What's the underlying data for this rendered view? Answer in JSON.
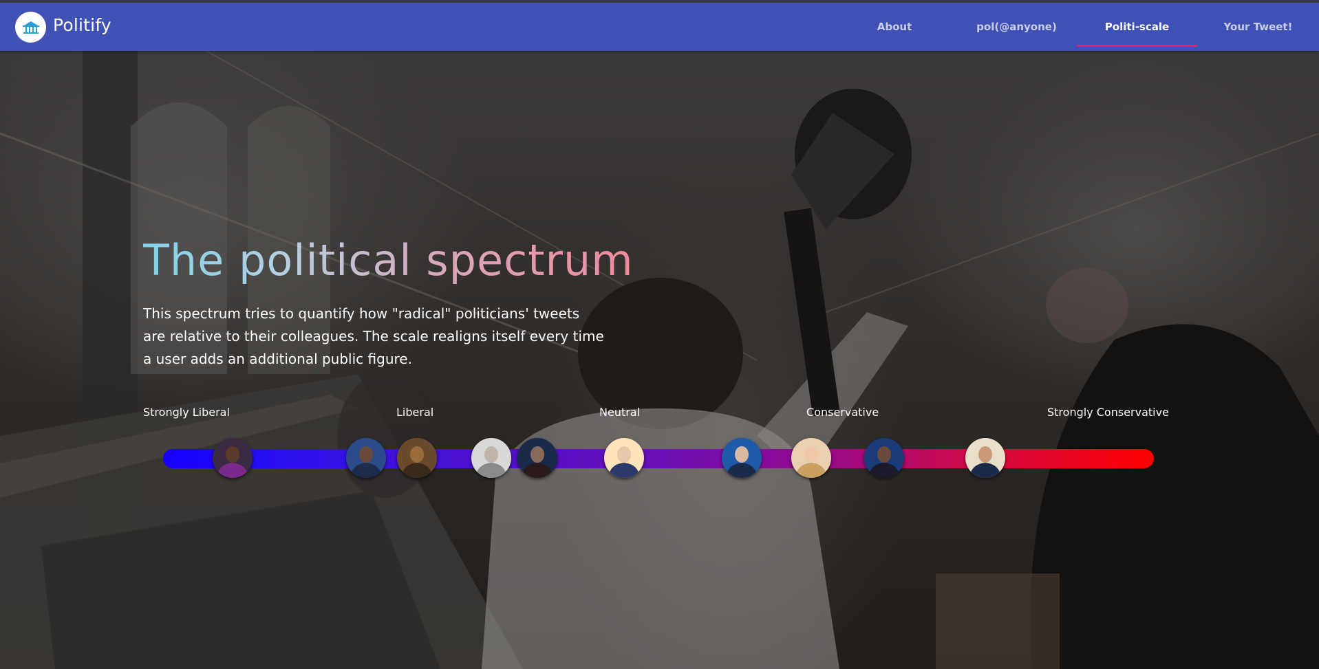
{
  "app": {
    "brand": "Politify",
    "logo_icon": "politify-logo-icon"
  },
  "nav": {
    "tabs": [
      {
        "label": "About",
        "active": false
      },
      {
        "label": "pol(@anyone)",
        "active": false
      },
      {
        "label": "Politi-scale",
        "active": true
      },
      {
        "label": "Your Tweet!",
        "active": false
      }
    ],
    "colors": {
      "bar": "#3f51b5",
      "indicator": "#e91e63"
    }
  },
  "hero": {
    "title": "The political spectrum",
    "description": "This spectrum tries to quantify how \"radical\" politicians' tweets are relative to their colleagues. The scale realigns itself every time a user adds an additional public figure."
  },
  "scale": {
    "labels": [
      "Strongly Liberal",
      "Liberal",
      "Neutral",
      "Conservative",
      "Strongly Conservative"
    ],
    "gradient": {
      "left": "#1600ff",
      "middle": "#6a10b6",
      "right": "#ff0000"
    },
    "figures": [
      {
        "name": "politician-avatar-1",
        "position": 0.07
      },
      {
        "name": "politician-avatar-2",
        "position": 0.205
      },
      {
        "name": "politician-avatar-3",
        "position": 0.256
      },
      {
        "name": "politician-avatar-4",
        "position": 0.331
      },
      {
        "name": "politician-avatar-5",
        "position": 0.378
      },
      {
        "name": "politician-avatar-6",
        "position": 0.465
      },
      {
        "name": "politician-avatar-7",
        "position": 0.584
      },
      {
        "name": "politician-avatar-8",
        "position": 0.654
      },
      {
        "name": "politician-avatar-9",
        "position": 0.728
      },
      {
        "name": "politician-avatar-10",
        "position": 0.83
      }
    ]
  }
}
